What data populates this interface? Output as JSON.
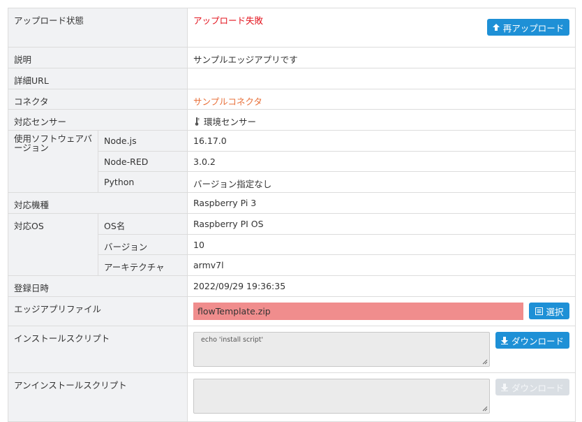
{
  "rows": {
    "upload_status": {
      "label": "アップロード状態",
      "value": "アップロード失敗",
      "button": "再アップロード"
    },
    "description": {
      "label": "説明",
      "value": "サンプルエッジアプリです"
    },
    "detail_url": {
      "label": "詳細URL",
      "value": ""
    },
    "connector": {
      "label": "コネクタ",
      "value": "サンプルコネクタ"
    },
    "sensor": {
      "label": "対応センサー",
      "value": "環境センサー",
      "icon": "thermometer-icon"
    },
    "software": {
      "label": "使用ソフトウェアバージョン",
      "items": [
        {
          "name": "Node.js",
          "value": "16.17.0"
        },
        {
          "name": "Node-RED",
          "value": "3.0.2"
        },
        {
          "name": "Python",
          "value": "バージョン指定なし"
        }
      ]
    },
    "model": {
      "label": "対応機種",
      "value": "Raspberry Pi 3"
    },
    "os": {
      "label": "対応OS",
      "items": [
        {
          "name": "OS名",
          "value": "Raspberry PI OS"
        },
        {
          "name": "バージョン",
          "value": "10"
        },
        {
          "name": "アーキテクチャ",
          "value": "armv7l"
        }
      ]
    },
    "registered": {
      "label": "登録日時",
      "value": "2022/09/29 19:36:35"
    },
    "app_file": {
      "label": "エッジアプリファイル",
      "value": "flowTemplate.zip",
      "button": "選択"
    },
    "install_script": {
      "label": "インストールスクリプト",
      "value": "echo 'install script'",
      "button": "ダウンロード"
    },
    "uninstall_script": {
      "label": "アンインストールスクリプト",
      "value": "",
      "button": "ダウンロード"
    }
  },
  "colors": {
    "error": "#e3131d",
    "link": "#e8703a",
    "primary_button": "#1e90d6",
    "disabled_button": "#d9dee3",
    "file_highlight": "#f08d8d",
    "label_bg": "#f1f2f4"
  }
}
